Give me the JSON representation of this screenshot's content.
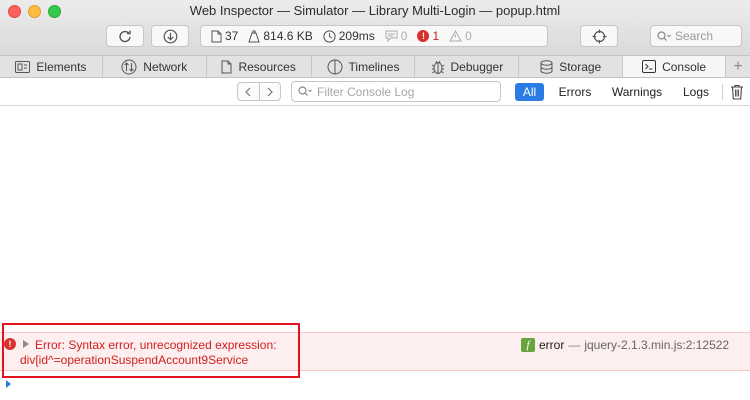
{
  "window": {
    "title": "Web Inspector — Simulator — Library Multi-Login — popup.html"
  },
  "toolbar": {
    "reload_icon": "reload-icon",
    "download_icon": "download-icon",
    "resources_count": "37",
    "transfer_size": "814.6 KB",
    "load_time": "209ms",
    "logs_count": "0",
    "errors_count": "1",
    "warnings_count": "0",
    "search_placeholder": "Search"
  },
  "tabs": [
    {
      "label": "Elements",
      "icon": "elements-icon"
    },
    {
      "label": "Network",
      "icon": "network-icon"
    },
    {
      "label": "Resources",
      "icon": "resources-icon"
    },
    {
      "label": "Timelines",
      "icon": "timelines-icon"
    },
    {
      "label": "Debugger",
      "icon": "debugger-icon"
    },
    {
      "label": "Storage",
      "icon": "storage-icon"
    },
    {
      "label": "Console",
      "icon": "console-icon",
      "active": true
    }
  ],
  "filter": {
    "placeholder": "Filter Console Log",
    "levels": [
      "All",
      "Errors",
      "Warnings",
      "Logs"
    ],
    "active_level": "All"
  },
  "message": {
    "line1": "Error: Syntax error, unrecognized expression:",
    "line2": "div[id^=operationSuspendAccount9Service",
    "function_name": "error",
    "separator": "—",
    "location": "jquery-2.1.3.min.js:2:12522"
  },
  "colors": {
    "accent": "#2a7be4",
    "error": "#d02020",
    "error_background": "#fdeeef",
    "highlight": "#e0141c"
  }
}
